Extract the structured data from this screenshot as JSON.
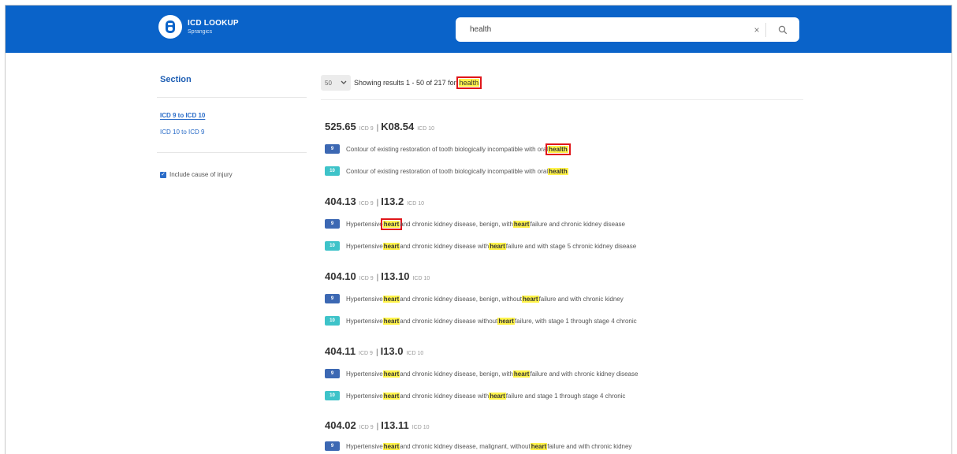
{
  "header": {
    "logo_title": "ICD LOOKUP",
    "logo_subtitle": "Sprangics",
    "brand_color": "#0a63c9",
    "search_value": "health",
    "clear_glyph": "×"
  },
  "sidebar": {
    "heading": "Section",
    "links": [
      "ICD 9 to ICD 10",
      "ICD 10 to ICD 9"
    ],
    "checkbox_label": "Include cause of injury",
    "checkbox_checked": true
  },
  "results": {
    "per_page": "50",
    "text": "Showing results 1 - 50 of 217 for",
    "query": "health"
  },
  "tags": {
    "icd9_label": "9",
    "icd10_label": "10",
    "icd_sep": "|",
    "icd9_tag": "ICD 9",
    "icd10_tag": "ICD 10"
  },
  "entries": [
    {
      "icd9": "525.65",
      "icd10": "K08.54",
      "d9": {
        "pre": "Contour of existing restoration of tooth biologically incompatible with oral ",
        "hl": "health",
        "post": ""
      },
      "d10": {
        "pre": "Contour of existing restoration of tooth biologically incompatible with oral ",
        "hl": "health",
        "post": ""
      }
    },
    {
      "icd9": "404.13",
      "icd10": "I13.2",
      "d9": {
        "pre": "Hypertensive ",
        "hl": "heart",
        "mid": " and chronic kidney disease, benign, with ",
        "hl2": "heart",
        "post": " failure and chronic kidney disease"
      },
      "d10": {
        "pre": "Hypertensive ",
        "hl": "heart",
        "mid": " and chronic kidney disease with ",
        "hl2": "heart",
        "post": " failure and with stage 5 chronic kidney disease"
      }
    },
    {
      "icd9": "404.10",
      "icd10": "I13.10",
      "d9": {
        "pre": "Hypertensive ",
        "hl": "heart",
        "mid": " and chronic kidney disease, benign, without ",
        "hl2": "heart",
        "post": " failure and with chronic kidney"
      },
      "d10": {
        "pre": "Hypertensive ",
        "hl": "heart",
        "mid": " and chronic kidney disease without ",
        "hl2": "heart",
        "post": " failure, with stage 1 through stage 4 chronic"
      }
    },
    {
      "icd9": "404.11",
      "icd10": "I13.0",
      "d9": {
        "pre": "Hypertensive ",
        "hl": "heart",
        "mid": " and chronic kidney disease, benign, with ",
        "hl2": "heart",
        "post": " failure and with chronic kidney disease"
      },
      "d10": {
        "pre": "Hypertensive ",
        "hl": "heart",
        "mid": " and chronic kidney disease with ",
        "hl2": "heart",
        "post": " failure and stage 1 through stage 4 chronic"
      }
    },
    {
      "icd9": "404.02",
      "icd10": "I13.11",
      "d9": {
        "pre": "Hypertensive ",
        "hl": "heart",
        "mid": " and chronic kidney disease, malignant, without ",
        "hl2": "heart",
        "post": " failure and with chronic kidney"
      }
    }
  ]
}
